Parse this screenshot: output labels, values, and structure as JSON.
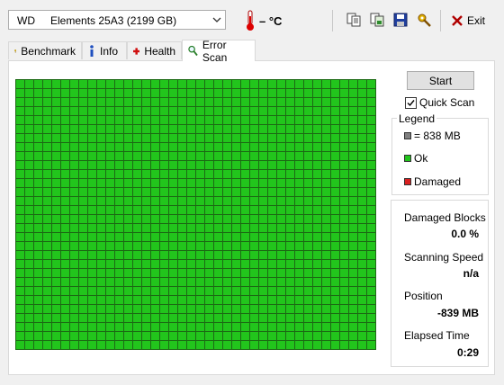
{
  "toolbar": {
    "drive_brand": "WD",
    "drive_model": "Elements 25A3 (2199 GB)",
    "temperature": "– °C",
    "exit_label": "Exit"
  },
  "tabs": [
    {
      "label": "Benchmark",
      "icon": "gauge-icon"
    },
    {
      "label": "Info",
      "icon": "info-icon"
    },
    {
      "label": "Health",
      "icon": "health-cross-icon"
    },
    {
      "label": "Error Scan",
      "icon": "magnifier-icon",
      "active": true
    }
  ],
  "scan": {
    "start_label": "Start",
    "quick_scan_label": "Quick Scan",
    "quick_scan_checked": true,
    "legend_title": "Legend",
    "legend": [
      {
        "label": "= 838 MB",
        "color": "#808080"
      },
      {
        "label": "Ok",
        "color": "#22c51c"
      },
      {
        "label": "Damaged",
        "color": "#d92020"
      }
    ],
    "stats": [
      {
        "label": "Damaged Blocks",
        "value": "0.0 %"
      },
      {
        "label": "Scanning Speed",
        "value": "n/a"
      },
      {
        "label": "Position",
        "value": "-839 MB"
      },
      {
        "label": "Elapsed Time",
        "value": "0:29"
      }
    ]
  },
  "grid": {
    "ok_color": "#22c51c",
    "line_color": "#1c6a14",
    "all_blocks_status": "ok"
  }
}
